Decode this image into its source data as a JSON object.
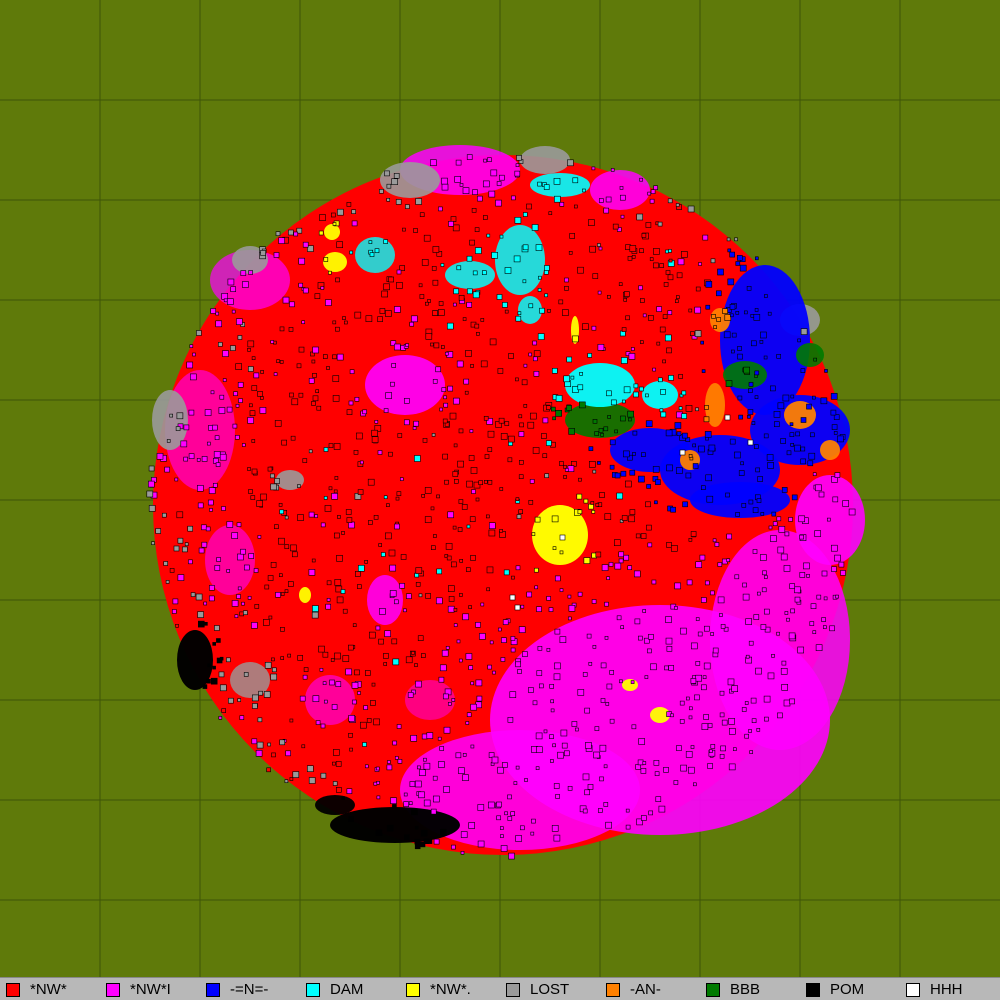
{
  "colors": {
    "background": "#5f7a0a",
    "grid_line": "#3e5408",
    "legend_bar": "#b8b8b8"
  },
  "map": {
    "grid": true,
    "grid_columns": 10,
    "grid_rows": 10,
    "shape": "circular galaxy"
  },
  "legend": [
    {
      "label": "*NW*",
      "color": "#ff0000"
    },
    {
      "label": "*NW*I",
      "color": "#ff00ff"
    },
    {
      "label": "-=N=-",
      "color": "#0000ff"
    },
    {
      "label": "DAM",
      "color": "#00ffff"
    },
    {
      "label": "*NW*.",
      "color": "#ffff00"
    },
    {
      "label": "LOST",
      "color": "#9a9a9a"
    },
    {
      "label": "-AN-",
      "color": "#ff8000"
    },
    {
      "label": "BBB",
      "color": "#007a00"
    },
    {
      "label": "POM",
      "color": "#000000"
    },
    {
      "label": "HHH",
      "color": "#ffffff"
    }
  ]
}
